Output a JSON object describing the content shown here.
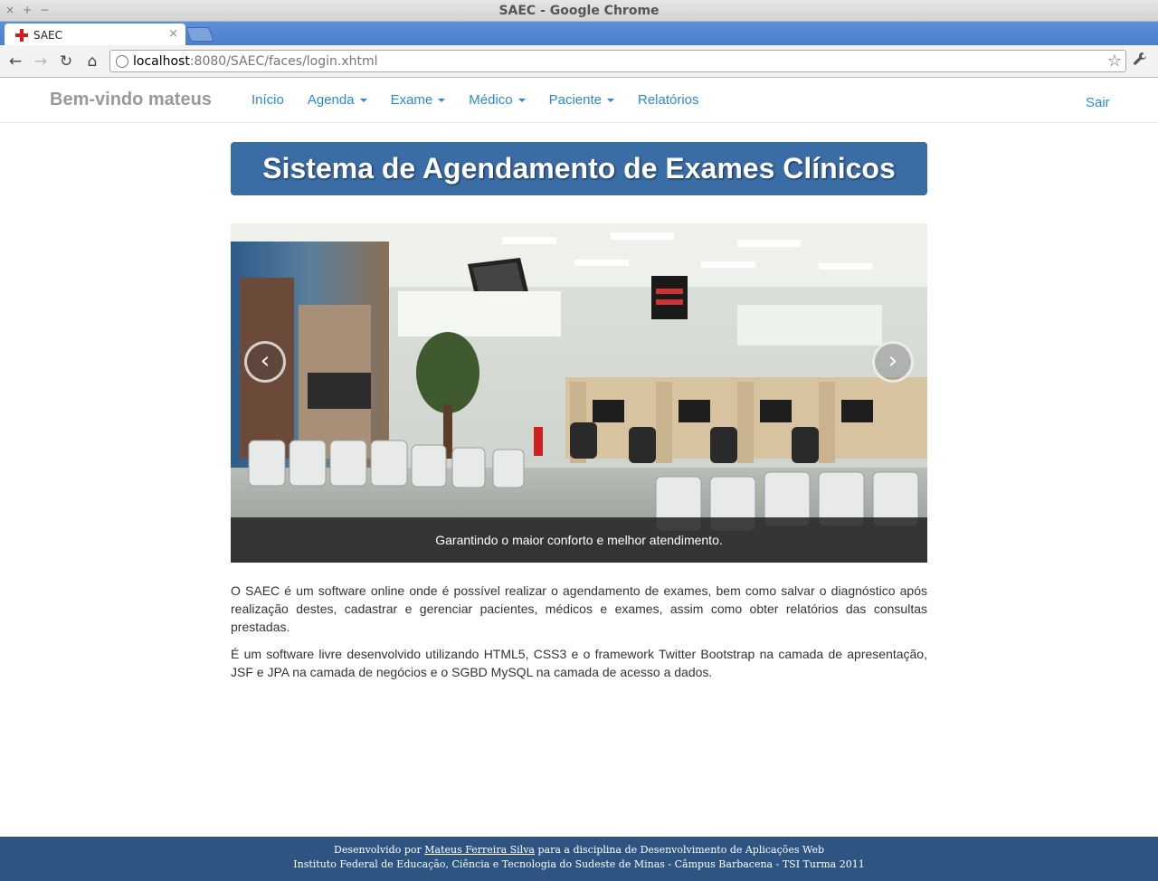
{
  "window": {
    "title": "SAEC - Google Chrome",
    "controls": [
      "×",
      "+",
      "−"
    ]
  },
  "tabs": [
    {
      "title": "SAEC",
      "close": "×",
      "favicon": "red-cross-icon"
    }
  ],
  "toolbar": {
    "back": "←",
    "forward": "→",
    "reload": "↻",
    "home": "⌂",
    "url_host": "localhost",
    "url_rest": ":8080/SAEC/faces/login.xhtml",
    "star": "☆",
    "wrench": "🔧"
  },
  "navbar": {
    "brand": "Bem-vindo mateus",
    "items": [
      {
        "label": "Início",
        "dropdown": false
      },
      {
        "label": "Agenda",
        "dropdown": true
      },
      {
        "label": "Exame",
        "dropdown": true
      },
      {
        "label": "Médico",
        "dropdown": true
      },
      {
        "label": "Paciente",
        "dropdown": true
      },
      {
        "label": "Relatórios",
        "dropdown": false
      }
    ],
    "logout": "Sair"
  },
  "hero": {
    "title": "Sistema de Agendamento de Exames Clínicos"
  },
  "carousel": {
    "caption": "Garantindo o maior conforto e melhor atendimento.",
    "prev": "‹",
    "next": "›",
    "image": "clinic-waiting-room-photo"
  },
  "content": {
    "paragraph1": "O SAEC é um software online onde é possível realizar o agendamento de exames, bem como salvar o diagnóstico após realização destes, cadastrar e gerenciar pacientes, médicos e exames, assim como obter relatórios das consultas prestadas.",
    "paragraph2": "É um software livre desenvolvido utilizando HTML5, CSS3 e o framework Twitter Bootstrap na camada de apresentação, JSF e JPA na camada de negócios e o SGBD MySQL na camada de acesso a dados."
  },
  "footer": {
    "line1_prefix": "Desenvolvido por ",
    "author": "Mateus Ferreira Silva",
    "line1_suffix": " para a disciplina de Desenvolvimento de Aplicações Web",
    "line2": "Instituto Federal de Educação, Ciência e Tecnologia do Sudeste de Minas - Câmpus Barbacena - TSI Turma 2011"
  },
  "colors": {
    "accent": "#2a8ad4",
    "hero_bg": "#3a6ca5",
    "footer_bg": "#2e5482",
    "tabstrip": "#5d8fd9"
  }
}
